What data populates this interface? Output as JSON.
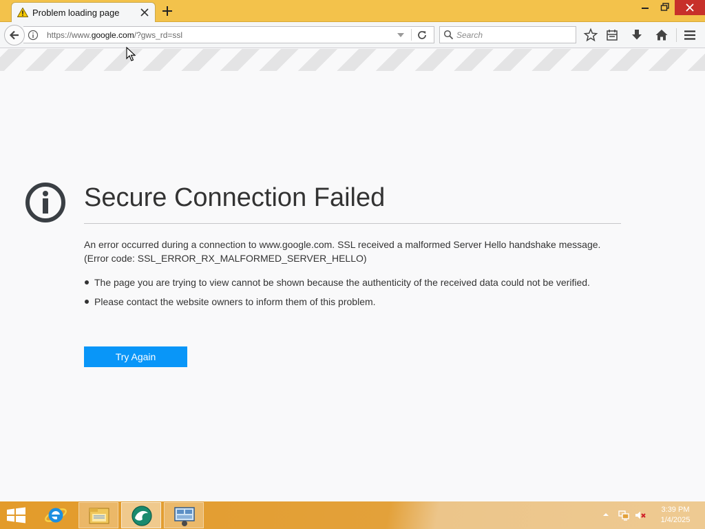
{
  "browser": {
    "tab": {
      "title": "Problem loading page"
    },
    "url": {
      "prefix": "https://www.",
      "host": "google.com",
      "suffix": "/?gws_rd=ssl"
    },
    "search": {
      "placeholder": "Search"
    }
  },
  "error_page": {
    "title": "Secure Connection Failed",
    "description": "An error occurred during a connection to www.google.com. SSL received a malformed Server Hello handshake message. (Error code: SSL_ERROR_RX_MALFORMED_SERVER_HELLO)",
    "bullets": [
      "The page you are trying to view cannot be shown because the authenticity of the received data could not be verified.",
      "Please contact the website owners to inform them of this problem."
    ],
    "button_label": "Try Again"
  },
  "taskbar": {
    "clock": {
      "time": "3:39 PM",
      "date": "1/4/2025"
    }
  },
  "colors": {
    "titlebar": "#f3c24b",
    "accent_button": "#0996f8",
    "taskbar": "#e39b2a",
    "close_button": "#c7302a"
  },
  "icons": [
    "warning-icon",
    "close-icon",
    "plus-icon",
    "back-arrow-icon",
    "info-icon",
    "dropdown-arrow-icon",
    "reload-icon",
    "search-icon",
    "star-icon",
    "library-icon",
    "download-icon",
    "home-icon",
    "hamburger-menu-icon",
    "error-info-icon",
    "windows-logo-icon",
    "internet-explorer-icon",
    "file-explorer-icon",
    "browser-app-icon",
    "remote-desktop-icon",
    "tray-expand-icon",
    "network-icon",
    "volume-muted-icon",
    "mouse-cursor-icon"
  ]
}
